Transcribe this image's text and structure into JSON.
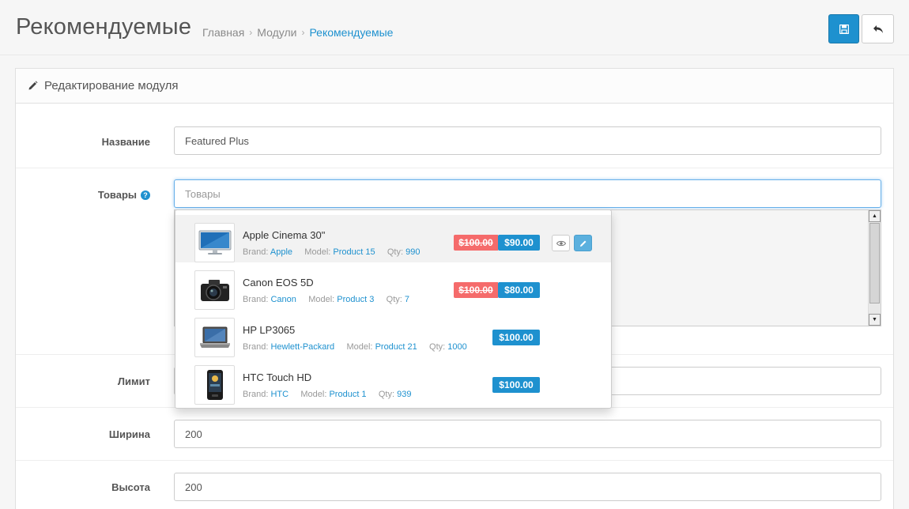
{
  "header": {
    "title": "Рекомендуемые",
    "breadcrumb": [
      "Главная",
      "Модули",
      "Рекомендуемые"
    ],
    "save_icon": "floppy-disk-icon",
    "back_icon": "reply-arrow-icon",
    "accent_color": "#1e91cf"
  },
  "panel": {
    "heading": "Редактирование модуля",
    "heading_icon": "pencil-icon"
  },
  "form": {
    "name_label": "Название",
    "name_value": "Featured Plus",
    "products_label": "Товары",
    "products_placeholder": "Товары",
    "limit_label": "Лимит",
    "width_label": "Ширина",
    "width_value": "200",
    "height_label": "Высота",
    "height_value": "200"
  },
  "autocomplete": {
    "brand_label": "Brand:",
    "model_label": "Model:",
    "qty_label": "Qty:",
    "items": [
      {
        "name": "Apple Cinema 30\"",
        "brand": "Apple",
        "model": "Product 15",
        "qty": "990",
        "old_price": "$100.00",
        "price": "$90.00",
        "image": "monitor"
      },
      {
        "name": "Canon EOS 5D",
        "brand": "Canon",
        "model": "Product 3",
        "qty": "7",
        "old_price": "$100.00",
        "price": "$80.00",
        "image": "camera"
      },
      {
        "name": "HP LP3065",
        "brand": "Hewlett-Packard",
        "model": "Product 21",
        "qty": "1000",
        "old_price": null,
        "price": "$100.00",
        "image": "laptop"
      },
      {
        "name": "HTC Touch HD",
        "brand": "HTC",
        "model": "Product 1",
        "qty": "939",
        "old_price": null,
        "price": "$100.00",
        "image": "phone"
      }
    ]
  }
}
